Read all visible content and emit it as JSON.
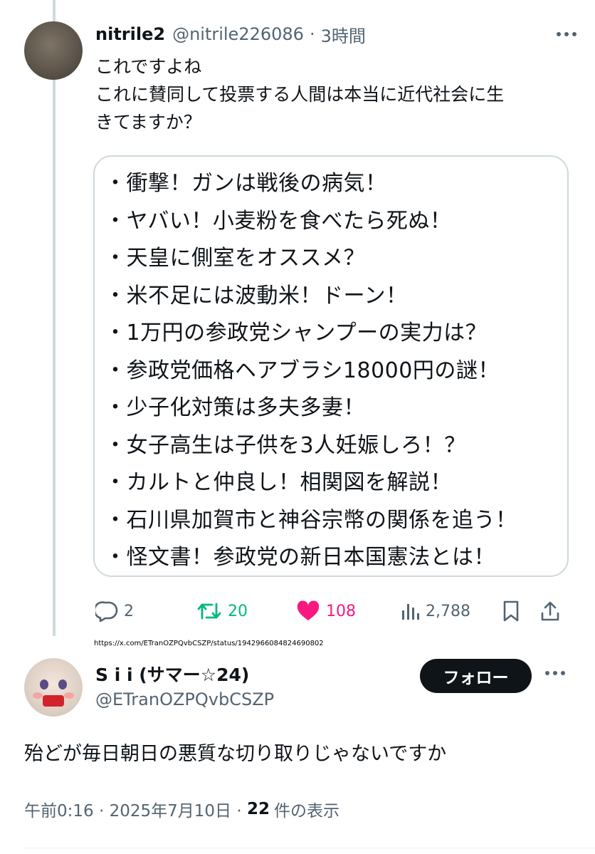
{
  "reply_tweet": {
    "author_name": "nitrile2",
    "author_handle": "@nitrile226086",
    "separator": "·",
    "time_ago": "3時間",
    "text": "これですよね\nこれに賛同して投票する人間は本当に近代社会に生\nきてますか？",
    "quoted_list": [
      "衝撃！ガンは戦後の病気！",
      "ヤバい！小麦粉を食べたら死ぬ！",
      "天皇に側室をオススメ？",
      "米不足には波動米！ドーン！",
      "1万円の参政党シャンプーの実力は？",
      "参政党価格ヘアブラシ18000円の謎！",
      "少子化対策は多夫多妻！",
      "女子高生は子供を3人妊娠しろ！？",
      "カルトと仲良し！相関図を解説！",
      "石川県加賀市と神谷宗幣の関係を追う！",
      "怪文書！参政党の新日本国憲法とは！"
    ],
    "actions": {
      "replies": "2",
      "retweets": "20",
      "likes": "108",
      "views": "2,788"
    }
  },
  "url_caption": "https://x.com/ETranOZPQvbCSZP/status/1942966084824690802",
  "main_tweet": {
    "author_name": "S i i (サマー☆24)",
    "author_handle": "@ETranOZPQvbCSZP",
    "follow_label": "フォロー",
    "text": "殆どが毎日朝日の悪質な切り取りじゃないですか",
    "timestamp": "午前0:16 · 2025年7月10日 · ",
    "views_count": "22",
    "views_label": "件の表示"
  },
  "colors": {
    "text": "#0f1419",
    "secondary": "#536471",
    "retweet_green": "#00ba7c",
    "like_pink": "#f91880",
    "border": "#cfd9de"
  },
  "icons": [
    "reply-icon",
    "retweet-icon",
    "heart-icon",
    "views-icon",
    "bookmark-icon",
    "share-icon",
    "more-icon"
  ]
}
